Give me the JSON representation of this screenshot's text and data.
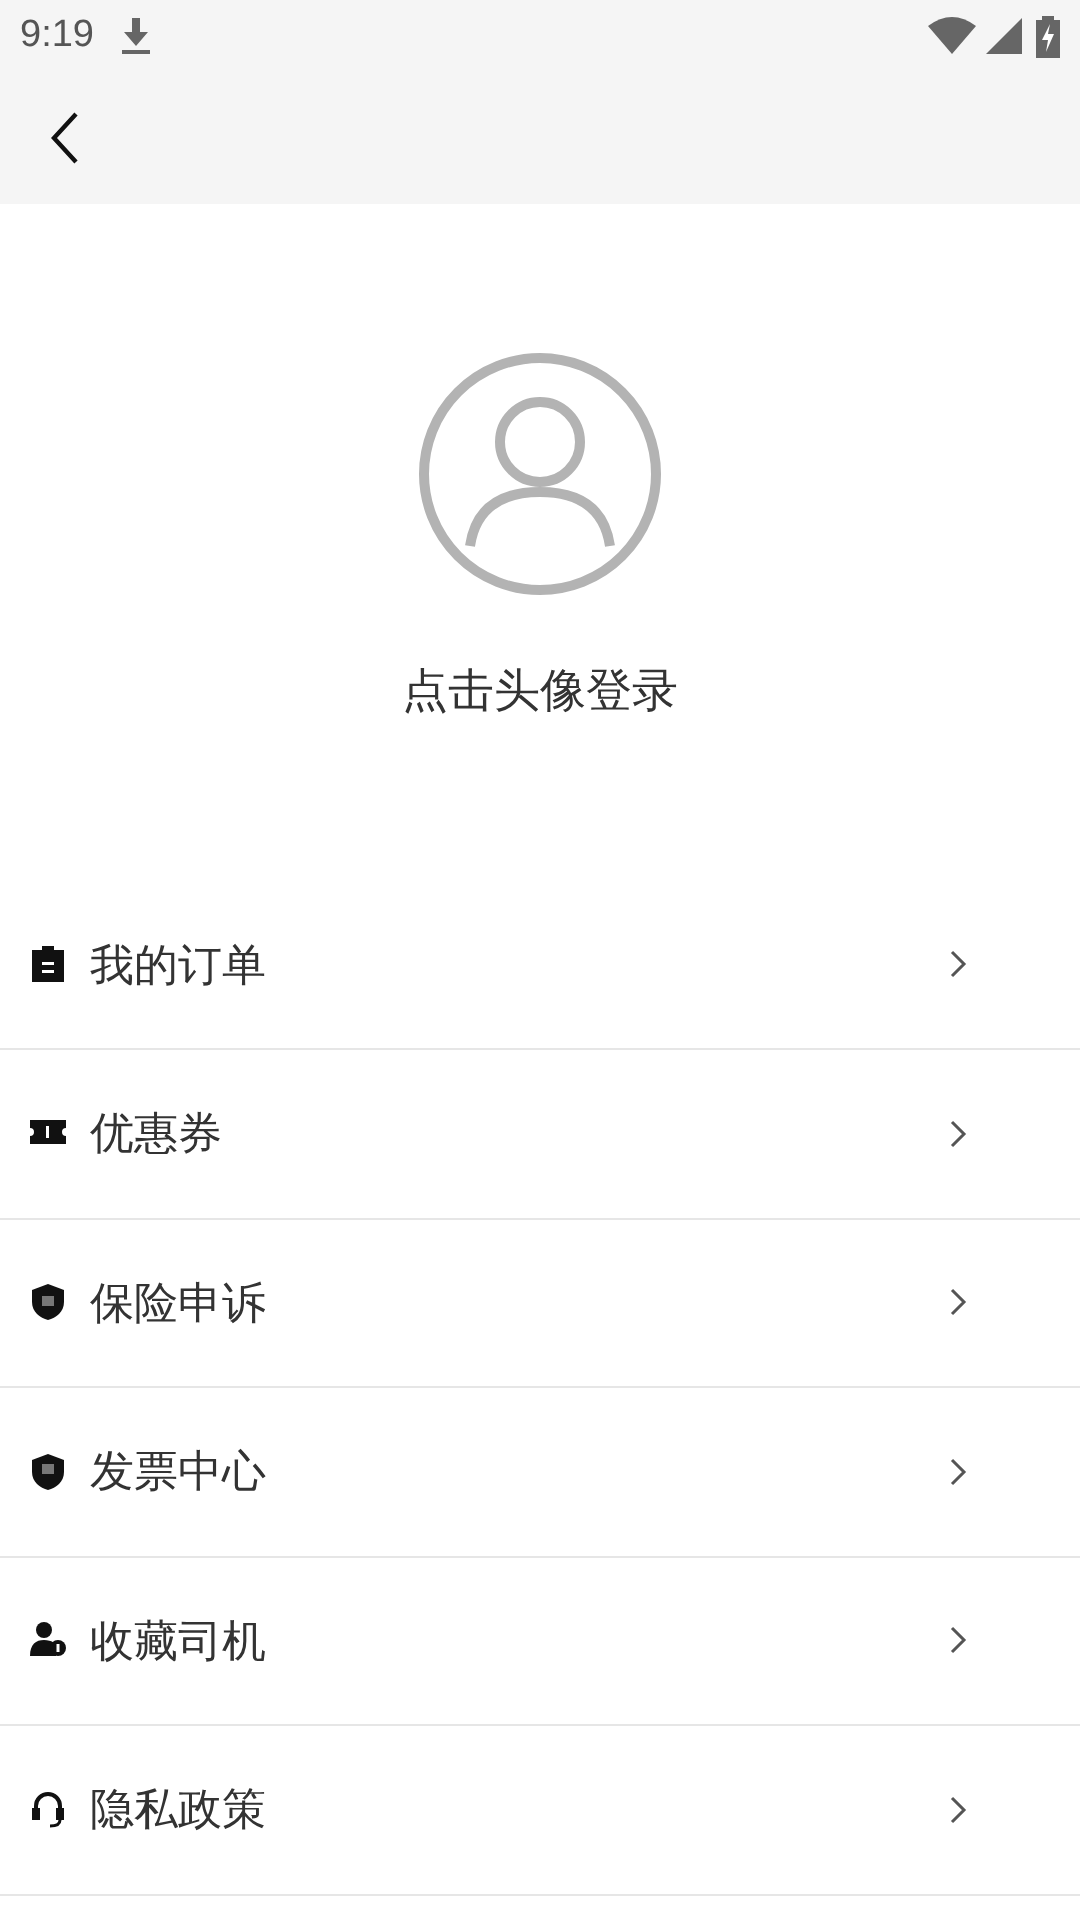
{
  "status_bar": {
    "time": "9:19"
  },
  "profile": {
    "login_prompt": "点击头像登录"
  },
  "menu": [
    {
      "label": "我的订单"
    },
    {
      "label": "优惠券"
    },
    {
      "label": "保险申诉"
    },
    {
      "label": "发票中心"
    },
    {
      "label": "收藏司机"
    },
    {
      "label": "隐私政策"
    }
  ]
}
